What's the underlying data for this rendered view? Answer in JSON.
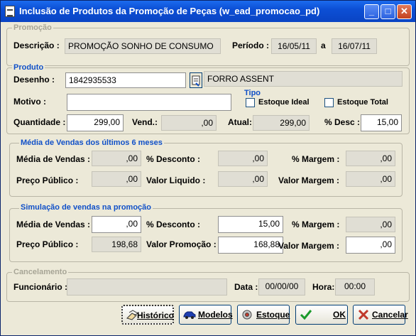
{
  "window": {
    "title": "Inclusão de Produtos da Promoção de Peças (w_ead_promocao_pd)"
  },
  "promocao": {
    "group_label": "Promoção",
    "descricao_label": "Descrição :",
    "descricao_value": "PROMOÇÃO SONHO DE CONSUMO",
    "periodo_label": "Período :",
    "periodo_inicio": "16/05/11",
    "periodo_sep": "a",
    "periodo_fim": "16/07/11"
  },
  "produto": {
    "group_label": "Produto",
    "desenho_label": "Desenho :",
    "desenho_value": "1842935533",
    "descricao_value": "FORRO ASSENT",
    "motivo_label": "Motivo :",
    "motivo_value": "",
    "tipo_label": "Tipo",
    "estoque_ideal_label": "Estoque Ideal",
    "estoque_total_label": "Estoque Total",
    "quantidade_label": "Quantidade :",
    "quantidade_value": "299,00",
    "vend_label": "Vend.:",
    "vend_value": ",00",
    "atual_label": "Atual:",
    "atual_value": "299,00",
    "desc_label": "% Desc :",
    "desc_value": "15,00"
  },
  "media": {
    "group_label": "Média de Vendas dos últimos 6 meses",
    "media_vendas_label": "Média de Vendas :",
    "media_vendas_value": ",00",
    "desconto_label": "% Desconto :",
    "desconto_value": ",00",
    "margem_label": "% Margem :",
    "margem_value": ",00",
    "preco_publico_label": "Preço Público :",
    "preco_publico_value": ",00",
    "valor_liquido_label": "Valor Liquido :",
    "valor_liquido_value": ",00",
    "valor_margem_label": "Valor Margem :",
    "valor_margem_value": ",00"
  },
  "simulacao": {
    "group_label": "Simulação de vendas na promoção",
    "media_vendas_label": "Média de Vendas :",
    "media_vendas_value": ",00",
    "desconto_label": "% Desconto :",
    "desconto_value": "15,00",
    "margem_label": "% Margem :",
    "margem_value": ",00",
    "preco_publico_label": "Preço Público :",
    "preco_publico_value": "198,68",
    "valor_promocao_label": "Valor Promoção :",
    "valor_promocao_value": "168,88",
    "valor_margem_label": "Valor Margem :",
    "valor_margem_value": ",00"
  },
  "cancelamento": {
    "group_label": "Cancelamento",
    "funcionario_label": "Funcionário :",
    "funcionario_value": "",
    "data_label": "Data :",
    "data_value": "00/00/00",
    "hora_label": "Hora:",
    "hora_value": "00:00"
  },
  "buttons": {
    "historico": "Histórico",
    "modelos": "Modelos",
    "estoque": "Estoque",
    "ok": "OK",
    "cancelar": "Cancelar"
  }
}
